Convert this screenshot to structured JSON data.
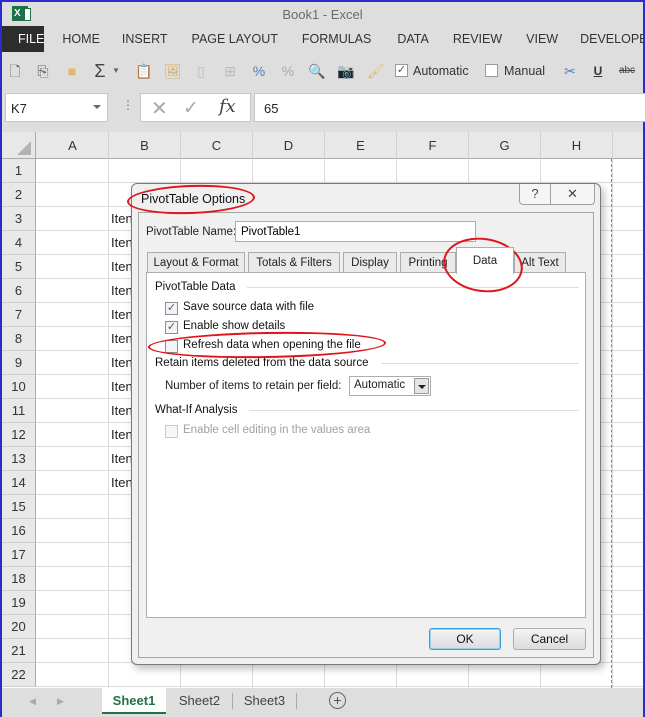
{
  "window": {
    "title": "Book1 - Excel",
    "app_icon": "excel-logo-icon"
  },
  "ribbon": {
    "tabs": [
      "FILE",
      "HOME",
      "INSERT",
      "PAGE LAYOUT",
      "FORMULAS",
      "DATA",
      "REVIEW",
      "VIEW",
      "DEVELOPE"
    ]
  },
  "toolbar": {
    "icons": [
      "new-document-icon",
      "copy-icon",
      "open-folder-icon",
      "autosum-icon",
      "paste-icon",
      "paste-picture-icon",
      "paste-values-icon",
      "paste-link-icon",
      "paste-format-icon",
      "paste-formulas-icon",
      "print-preview-icon",
      "camera-icon",
      "format-painter-icon",
      "cut-icon",
      "underline-icon",
      "strikethrough-icon"
    ],
    "automatic_label": "Automatic",
    "automatic_checked": true,
    "manual_label": "Manual",
    "manual_checked": false,
    "underline_glyph": "U",
    "strike_glyph": "abc",
    "sigma_glyph": "Σ"
  },
  "formula_bar": {
    "name_box": "K7",
    "cancel_glyph": "✕",
    "enter_glyph": "✓",
    "fx_label": "fx",
    "value": "65"
  },
  "grid": {
    "columns": [
      "A",
      "B",
      "C",
      "D",
      "E",
      "F",
      "G",
      "H"
    ],
    "rows": [
      "1",
      "2",
      "3",
      "4",
      "5",
      "6",
      "7",
      "8",
      "9",
      "10",
      "11",
      "12",
      "13",
      "14",
      "15",
      "16",
      "17",
      "18",
      "19",
      "20",
      "21",
      "22"
    ],
    "b_column_cells": [
      "",
      "",
      "Iten",
      "Iten",
      "Iten",
      "Iten",
      "Iten",
      "Iten",
      "Iten",
      "Iten",
      "Iten",
      "Iten",
      "Iten",
      "Iten"
    ]
  },
  "sheets": {
    "tabs": [
      "Sheet1",
      "Sheet2",
      "Sheet3"
    ],
    "active": "Sheet1",
    "add_glyph": "+",
    "prev_glyph": "◀",
    "next_glyph": "▶"
  },
  "dialog": {
    "title": "PivotTable Options",
    "help_glyph": "?",
    "close_glyph": "✕",
    "name_label": "PivotTable Name:",
    "name_value": "PivotTable1",
    "tabs": [
      "Layout & Format",
      "Totals & Filters",
      "Display",
      "Printing",
      "Data",
      "Alt Text"
    ],
    "active_tab": "Data",
    "sections": {
      "pivot_data": {
        "label": "PivotTable Data",
        "options": [
          {
            "label": "Save source data with file",
            "checked": true,
            "enabled": true
          },
          {
            "label": "Enable show details",
            "checked": true,
            "enabled": true
          },
          {
            "label": "Refresh data when opening the file",
            "checked": false,
            "enabled": true
          }
        ]
      },
      "retain": {
        "label": "Retain items deleted from the data source",
        "field_label": "Number of items to retain per field:",
        "selected": "Automatic"
      },
      "what_if": {
        "label": "What-If Analysis",
        "options": [
          {
            "label": "Enable cell editing in the values area",
            "checked": false,
            "enabled": false
          }
        ]
      }
    },
    "ok_label": "OK",
    "cancel_label": "Cancel"
  },
  "annotations": {
    "color": "#e0141b",
    "circled": [
      "dialog-title",
      "tab-data",
      "refresh-data-option"
    ]
  }
}
